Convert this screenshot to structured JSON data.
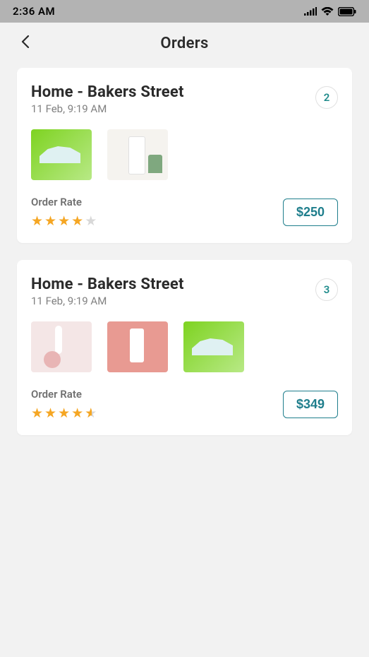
{
  "status": {
    "time": "2:36 AM"
  },
  "header": {
    "title": "Orders"
  },
  "orders": [
    {
      "address": "Home - Bakers Street",
      "datetime": "11 Feb, 9:19 AM",
      "count": "2",
      "rate_label": "Order Rate",
      "rating": 4,
      "rating_type": "full",
      "price": "$250",
      "thumbs": [
        "shoe-green",
        "cosmetics-white"
      ]
    },
    {
      "address": "Home - Bakers Street",
      "datetime": "11 Feb, 9:19 AM",
      "count": "3",
      "rate_label": "Order Rate",
      "rating": 4,
      "rating_type": "half",
      "price": "$349",
      "thumbs": [
        "cosmetics-pink",
        "bottle-pink",
        "shoe-green"
      ]
    }
  ]
}
